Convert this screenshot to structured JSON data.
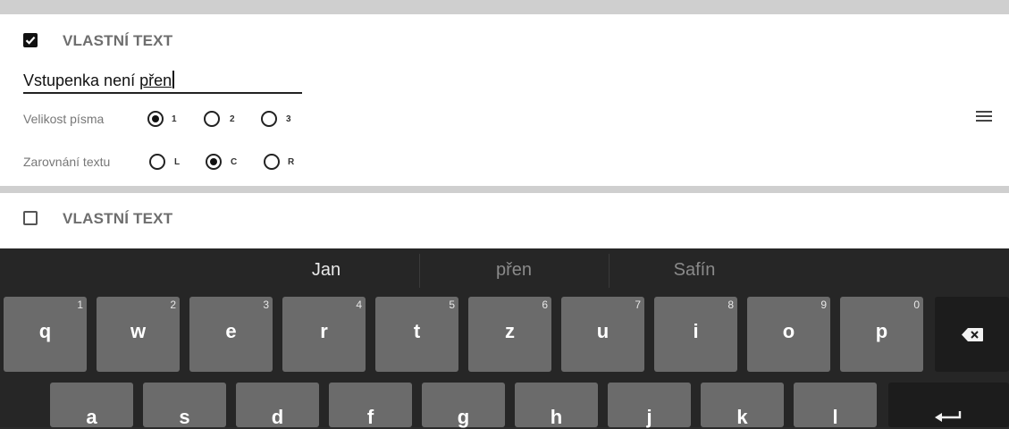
{
  "sections": [
    {
      "checked": true,
      "title": "VLASTNÍ TEXT",
      "text_value": "Vstupenka není ",
      "text_composing": "přen",
      "font_size": {
        "label": "Velikost písma",
        "options": [
          "1",
          "2",
          "3"
        ],
        "selected": "1"
      },
      "alignment": {
        "label": "Zarovnání textu",
        "options": [
          "L",
          "C",
          "R"
        ],
        "selected": "C"
      }
    },
    {
      "checked": false,
      "title": "VLASTNÍ TEXT"
    }
  ],
  "menu_icon": "hamburger-menu-icon",
  "keyboard": {
    "suggestions": [
      "Jan",
      "přen",
      "Safín"
    ],
    "row1": [
      {
        "key": "q",
        "hint": "1"
      },
      {
        "key": "w",
        "hint": "2"
      },
      {
        "key": "e",
        "hint": "3"
      },
      {
        "key": "r",
        "hint": "4"
      },
      {
        "key": "t",
        "hint": "5"
      },
      {
        "key": "z",
        "hint": "6"
      },
      {
        "key": "u",
        "hint": "7"
      },
      {
        "key": "i",
        "hint": "8"
      },
      {
        "key": "o",
        "hint": "9"
      },
      {
        "key": "p",
        "hint": "0"
      }
    ],
    "row2": [
      "a",
      "s",
      "d",
      "f",
      "g",
      "h",
      "j",
      "k",
      "l"
    ],
    "backspace_icon": "backspace-icon",
    "enter_icon": "enter-icon"
  }
}
